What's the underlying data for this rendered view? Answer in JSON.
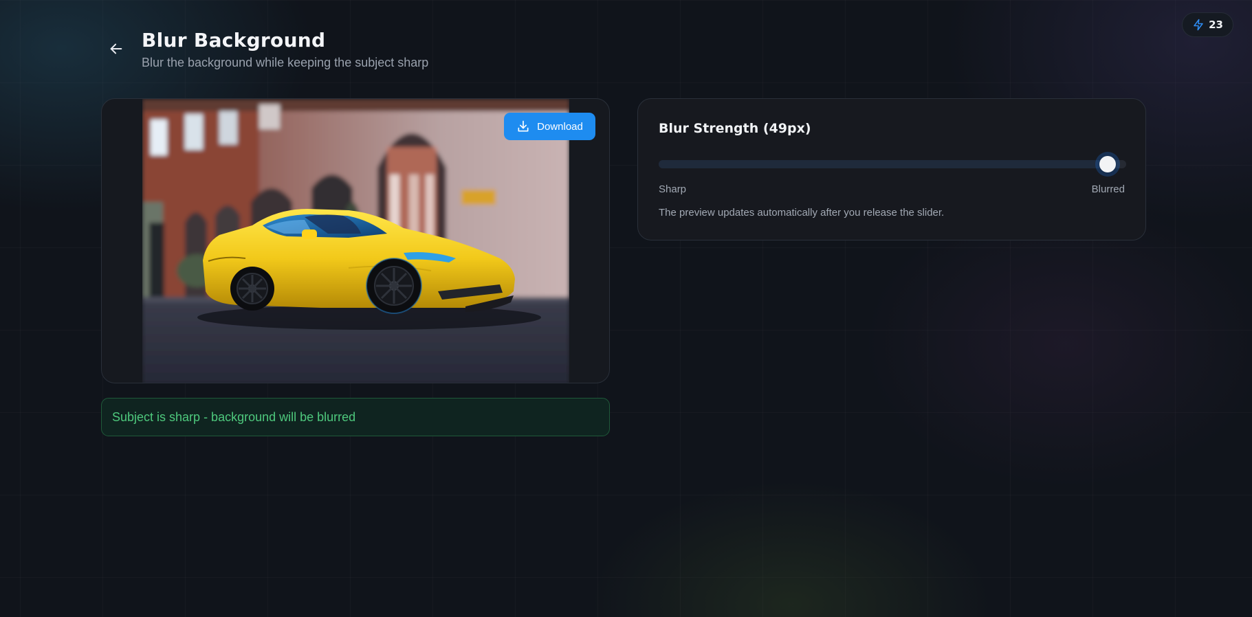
{
  "header": {
    "title": "Blur Background",
    "subtitle": "Blur the background while keeping the subject sharp",
    "back_icon": "arrow-left-icon"
  },
  "credits": {
    "icon": "lightning-bolt-icon",
    "count": "23",
    "accent_color": "#1e8cf0"
  },
  "preview": {
    "download_label": "Download",
    "download_icon": "download-icon",
    "subject": "yellow sports car in front of a blurred brick building"
  },
  "status": {
    "text": "Subject is sharp - background will be blurred",
    "color": "#4ec97d"
  },
  "controls": {
    "slider_label": "Blur Strength (49px)",
    "slider_value": 49,
    "slider_min": 0,
    "slider_max": 50,
    "scale_min_label": "Sharp",
    "scale_max_label": "Blurred",
    "helper_text": "The preview updates automatically after you release the slider."
  }
}
